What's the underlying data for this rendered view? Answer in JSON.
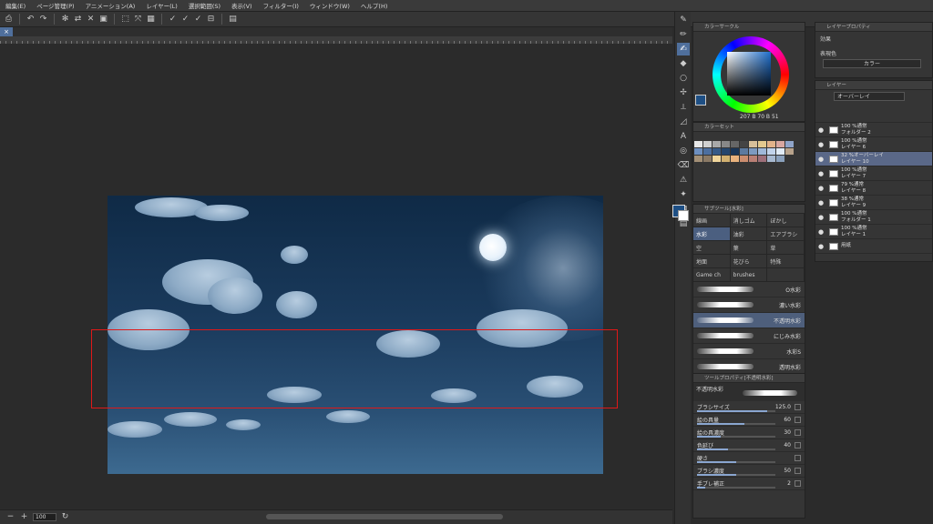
{
  "menu": [
    "編集(E)",
    "ページ管理(P)",
    "アニメーション(A)",
    "レイヤー(L)",
    "選択範囲(S)",
    "表示(V)",
    "フィルター(I)",
    "ウィンドウ(W)",
    "ヘルプ(H)"
  ],
  "colors": {
    "accent": "#4f6f9c",
    "highlight_box": "#e01818",
    "main_color": "#1e4f84"
  },
  "command_bar": {
    "icons": [
      "print-icon",
      "undo-icon",
      "redo-icon",
      "settings-icon",
      "transfer-icon",
      "delete-icon",
      "fill-icon",
      "clear-icon",
      "transform-icon",
      "grid-icon",
      "check-icon",
      "check-icon",
      "check-icon",
      "ruler-icon",
      "list-icon"
    ]
  },
  "color_panel": {
    "title": "カラーサークル",
    "readout": "207 B 70 B 51"
  },
  "colorset_panel": {
    "title": "カラーセット"
  },
  "subtool_panel": {
    "title": "サブツール[水彩]",
    "rows": [
      [
        "線画",
        "消しゴム",
        "ぼかし"
      ],
      [
        "水彩",
        "油彩",
        "エアブラシ"
      ],
      [
        "空",
        "葉",
        "草"
      ],
      [
        "地面",
        "花びら",
        "特殊"
      ],
      [
        "Game ch",
        "brushes",
        ""
      ]
    ],
    "active": "水彩",
    "brushes": [
      "O水彩",
      "濃い水彩",
      "不透明水彩",
      "にじみ水彩",
      "水彩S",
      "透明水彩"
    ],
    "selected_brush": "不透明水彩"
  },
  "tool_property": {
    "title": "ツールプロパティ[不透明水彩]",
    "brush_name": "不透明水彩",
    "props": [
      {
        "label": "ブラシサイズ",
        "value": "125.0",
        "fill": 0.9
      },
      {
        "label": "絵の具量",
        "value": "60",
        "fill": 0.6
      },
      {
        "label": "絵の具濃度",
        "value": "30",
        "fill": 0.3
      },
      {
        "label": "色延び",
        "value": "40",
        "fill": 0.4
      },
      {
        "label": "硬さ",
        "value": "",
        "fill": 0.5
      },
      {
        "label": "ブラシ濃度",
        "value": "50",
        "fill": 0.5
      },
      {
        "label": "手ブレ補正",
        "value": "2",
        "fill": 0.1
      }
    ]
  },
  "effects_panel": {
    "title": "レイヤープロパティ",
    "label": "効果",
    "color_label": "表現色",
    "color_value": "カラー"
  },
  "layer_panel": {
    "title": "レイヤー",
    "blend_mode": "オーバーレイ",
    "layers": [
      {
        "line1": "100 %通常",
        "line2": "フォルダー 2",
        "selected": false
      },
      {
        "line1": "100 %通常",
        "line2": "レイヤー 6",
        "selected": false
      },
      {
        "line1": "32 %オーバーレイ",
        "line2": "レイヤー 10",
        "selected": true
      },
      {
        "line1": "100 %通常",
        "line2": "レイヤー 7",
        "selected": false
      },
      {
        "line1": "79 %通常",
        "line2": "レイヤー 8",
        "selected": false
      },
      {
        "line1": "38 %通常",
        "line2": "レイヤー 9",
        "selected": false
      },
      {
        "line1": "100 %通常",
        "line2": "フォルダー 1",
        "selected": false
      },
      {
        "line1": "100 %通常",
        "line2": "レイヤー 1",
        "selected": false
      },
      {
        "line1": "",
        "line2": "用紙",
        "selected": false
      }
    ]
  },
  "zoom": "100"
}
